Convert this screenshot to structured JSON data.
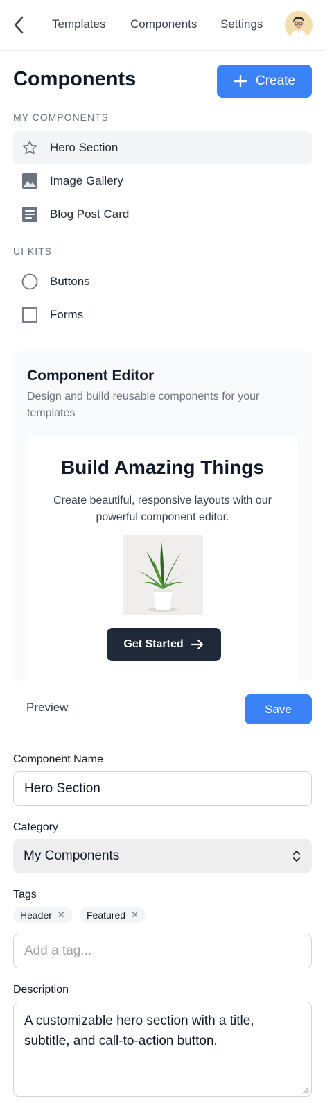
{
  "topnav": {
    "links": [
      "Templates",
      "Components",
      "Settings"
    ]
  },
  "sidebar": {
    "title": "Components",
    "create_label": "Create",
    "my_components_label": "MY COMPONENTS",
    "my_components": [
      {
        "label": "Hero Section",
        "icon": "star-icon",
        "active": true
      },
      {
        "label": "Image Gallery",
        "icon": "image-icon",
        "active": false
      },
      {
        "label": "Blog Post Card",
        "icon": "document-icon",
        "active": false
      }
    ],
    "ui_kits_label": "UI KITS",
    "ui_kits": [
      {
        "label": "Buttons",
        "icon": "circle-icon"
      },
      {
        "label": "Forms",
        "icon": "square-icon"
      }
    ]
  },
  "editor": {
    "title": "Component Editor",
    "subtitle": "Design and build reusable components for your templates",
    "preview": {
      "headline": "Build Amazing Things",
      "description": "Create beautiful, responsive layouts with our powerful component editor.",
      "cta_label": "Get Started"
    }
  },
  "actions": {
    "preview_label": "Preview",
    "save_label": "Save"
  },
  "form": {
    "name_label": "Component Name",
    "name_value": "Hero Section",
    "category_label": "Category",
    "category_value": "My Components",
    "tags_label": "Tags",
    "tags": [
      "Header",
      "Featured"
    ],
    "tag_placeholder": "Add a tag...",
    "description_label": "Description",
    "description_value": "A customizable hero section with a title, subtitle, and call-to-action button."
  },
  "colors": {
    "accent": "#3b82f6",
    "dark_button": "#1f2937",
    "active_item_bg": "#f3f4f6"
  }
}
